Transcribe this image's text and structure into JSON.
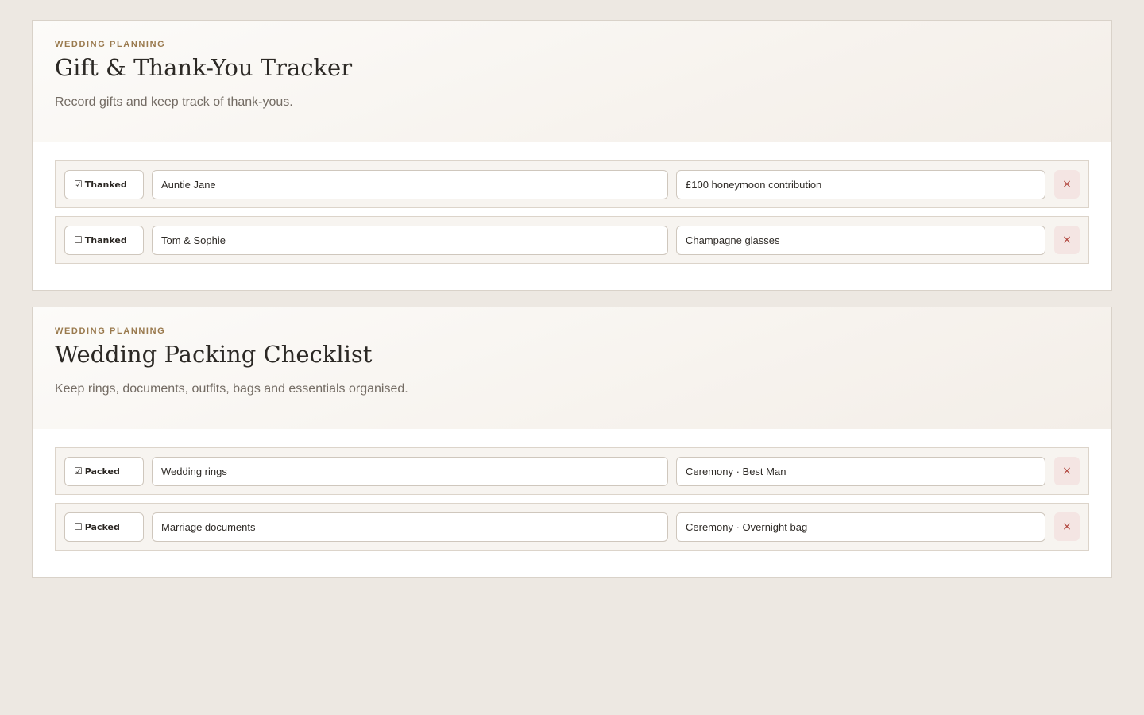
{
  "sections": [
    {
      "eyebrow": "WEDDING PLANNING",
      "title": "Gift & Thank-You Tracker",
      "subtitle": "Record gifts and keep track of thank-yous.",
      "rows": [
        {
          "checkbox": "☑",
          "toggle_label": "Thanked",
          "name": "Auntie Jane",
          "detail": "£100 honeymoon contribution",
          "remove": "×"
        },
        {
          "checkbox": "☐",
          "toggle_label": "Thanked",
          "name": "Tom & Sophie",
          "detail": "Champagne glasses",
          "remove": "×"
        }
      ]
    },
    {
      "eyebrow": "WEDDING PLANNING",
      "title": "Wedding Packing Checklist",
      "subtitle": "Keep rings, documents, outfits, bags and essentials organised.",
      "rows": [
        {
          "checkbox": "☑",
          "toggle_label": "Packed",
          "name": "Wedding rings",
          "detail": "Ceremony · Best Man",
          "remove": "×"
        },
        {
          "checkbox": "☐",
          "toggle_label": "Packed",
          "name": "Marriage documents",
          "detail": "Ceremony · Overnight bag",
          "remove": "×"
        }
      ]
    }
  ],
  "icons": {
    "remove": "close-icon",
    "checked": "checkbox-checked-icon",
    "unchecked": "checkbox-unchecked-icon"
  },
  "colors": {
    "accent": "#9a7a4e",
    "remove": "#b0443c",
    "background": "#ede8e2"
  }
}
